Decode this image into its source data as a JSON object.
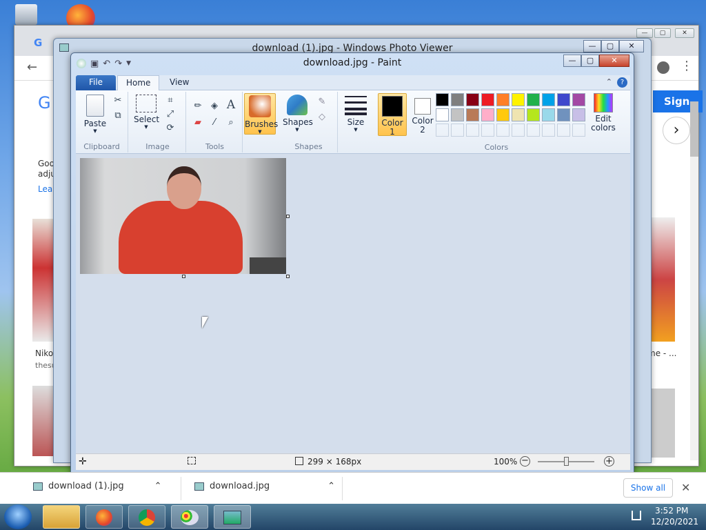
{
  "photo_viewer": {
    "title": "download (1).jpg - Windows Photo Viewer"
  },
  "paint": {
    "title": "download.jpg - Paint",
    "window_controls": {
      "minimize": "—",
      "maximize": "▢",
      "close": "✕"
    },
    "menu": {
      "file": "File",
      "home": "Home",
      "view": "View"
    },
    "ribbon": {
      "clipboard": {
        "paste": "Paste",
        "label": "Clipboard"
      },
      "image": {
        "select": "Select",
        "label": "Image"
      },
      "tools": {
        "label": "Tools"
      },
      "brushes": "Brushes",
      "shapes": {
        "shapes": "Shapes",
        "label": "Shapes"
      },
      "size": "Size",
      "color1_line1": "Color",
      "color1_line2": "1",
      "color2_line1": "Color",
      "color2_line2": "2",
      "edit_colors_line1": "Edit",
      "edit_colors_line2": "colors",
      "colors_label": "Colors"
    },
    "palette_row1": [
      "#000000",
      "#7f7f7f",
      "#880015",
      "#ed1c24",
      "#ff7f27",
      "#fff200",
      "#22b14c",
      "#00a2e8",
      "#3f48cc",
      "#a349a4"
    ],
    "palette_row2": [
      "#ffffff",
      "#c3c3c3",
      "#b97a57",
      "#ffaec9",
      "#ffc90e",
      "#efe4b0",
      "#b5e61d",
      "#99d9ea",
      "#7092be",
      "#c8bfe7"
    ],
    "status": {
      "dimensions": "299 × 168px",
      "zoom": "100%"
    }
  },
  "chrome": {
    "sign_in": "Sign in",
    "left_snippets": [
      "Goo",
      "adju",
      "Lea",
      "Niko",
      "thesu"
    ],
    "right_snippet": "me - ..."
  },
  "downloads": {
    "items": [
      "download (1).jpg",
      "download.jpg"
    ],
    "show_all": "Show all"
  },
  "clock": {
    "time": "3:52 PM",
    "date": "12/20/2021"
  }
}
